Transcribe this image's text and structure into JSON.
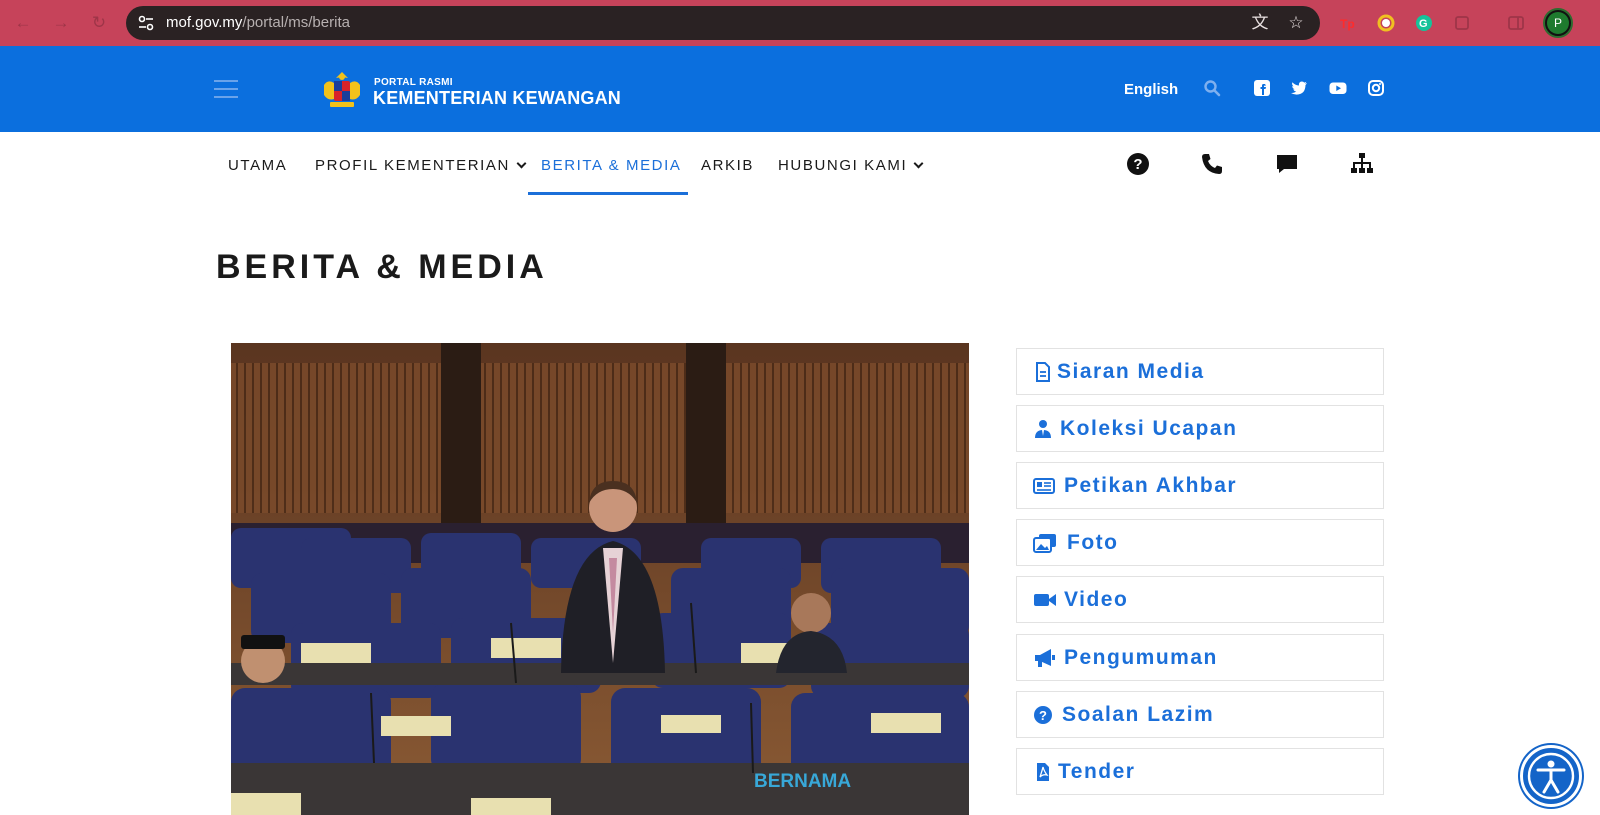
{
  "browser": {
    "url_host": "mof.gov.my",
    "url_path": "/portal/ms/berita",
    "profile_initial": "P"
  },
  "header": {
    "portal_small": "PORTAL RASMI",
    "portal_big": "KEMENTERIAN KEWANGAN",
    "language": "English",
    "social_icons": [
      "facebook-icon",
      "twitter-icon",
      "youtube-icon",
      "instagram-icon"
    ]
  },
  "nav": {
    "items": [
      {
        "label": "UTAMA"
      },
      {
        "label": "PROFIL KEMENTERIAN"
      },
      {
        "label": "BERITA & MEDIA"
      },
      {
        "label": "ARKIB"
      },
      {
        "label": "HUBUNGI KAMI"
      }
    ],
    "active": "BERITA & MEDIA",
    "right_icons": [
      "question-circle-icon",
      "phone-icon",
      "comment-icon",
      "sitemap-icon"
    ]
  },
  "page": {
    "title": "BERITA & MEDIA",
    "photo_watermark": "BERNAMA"
  },
  "side_menu": [
    {
      "label": "Siaran Media",
      "icon": "file-icon"
    },
    {
      "label": "Koleksi Ucapan",
      "icon": "user-tie-icon"
    },
    {
      "label": "Petikan Akhbar",
      "icon": "newspaper-icon"
    },
    {
      "label": "Foto",
      "icon": "photo-icon"
    },
    {
      "label": "Video",
      "icon": "video-icon"
    },
    {
      "label": "Pengumuman",
      "icon": "bullhorn-icon"
    },
    {
      "label": "Soalan Lazim",
      "icon": "question-circle-icon"
    },
    {
      "label": "Tender",
      "icon": "file-pdf-icon"
    }
  ],
  "colors": {
    "chrome_accent": "#c6435a",
    "header_blue": "#0b6fde",
    "link_blue": "#1b6fd9"
  }
}
